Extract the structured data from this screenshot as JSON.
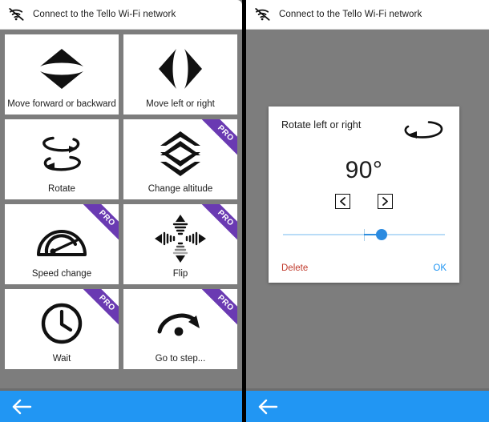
{
  "panels": {
    "left": {
      "topbar": {
        "icon": "wifi-off-icon",
        "text": "Connect to the Tello Wi-Fi network"
      },
      "back_label": "back-arrow-icon",
      "cards": [
        {
          "label": "Move forward or backward",
          "icon": "move-forward-backward-icon",
          "pro": false
        },
        {
          "label": "Move left or right",
          "icon": "move-left-right-icon",
          "pro": false
        },
        {
          "label": "Rotate",
          "icon": "rotate-icon",
          "pro": false
        },
        {
          "label": "Change altitude",
          "icon": "change-altitude-icon",
          "pro": true
        },
        {
          "label": "Speed change",
          "icon": "speedometer-icon",
          "pro": true
        },
        {
          "label": "Flip",
          "icon": "flip-icon",
          "pro": true
        },
        {
          "label": "Wait",
          "icon": "clock-icon",
          "pro": true
        },
        {
          "label": "Go to step...",
          "icon": "goto-step-icon",
          "pro": true
        }
      ],
      "pro_badge_label": "PRO"
    },
    "right": {
      "topbar": {
        "icon": "wifi-off-icon",
        "text": "Connect to the Tello Wi-Fi network"
      },
      "back_label": "back-arrow-icon",
      "dialog": {
        "title": "Rotate left or right",
        "header_icon": "rotate-loop-icon",
        "value": "90°",
        "stepper_left": "chevron-left-icon",
        "stepper_right": "chevron-right-icon",
        "slider": {
          "thumb_percent": 61,
          "tick_percent": 50
        },
        "delete_label": "Delete",
        "ok_label": "OK"
      }
    }
  },
  "colors": {
    "accent_blue": "#2196f3",
    "pro_purple": "#6a3ab2",
    "delete_red": "#c0392b",
    "panel_gray": "#7d7d7d",
    "slider_track": "#b9dcf7",
    "slider_fill": "#2f8fe0"
  }
}
